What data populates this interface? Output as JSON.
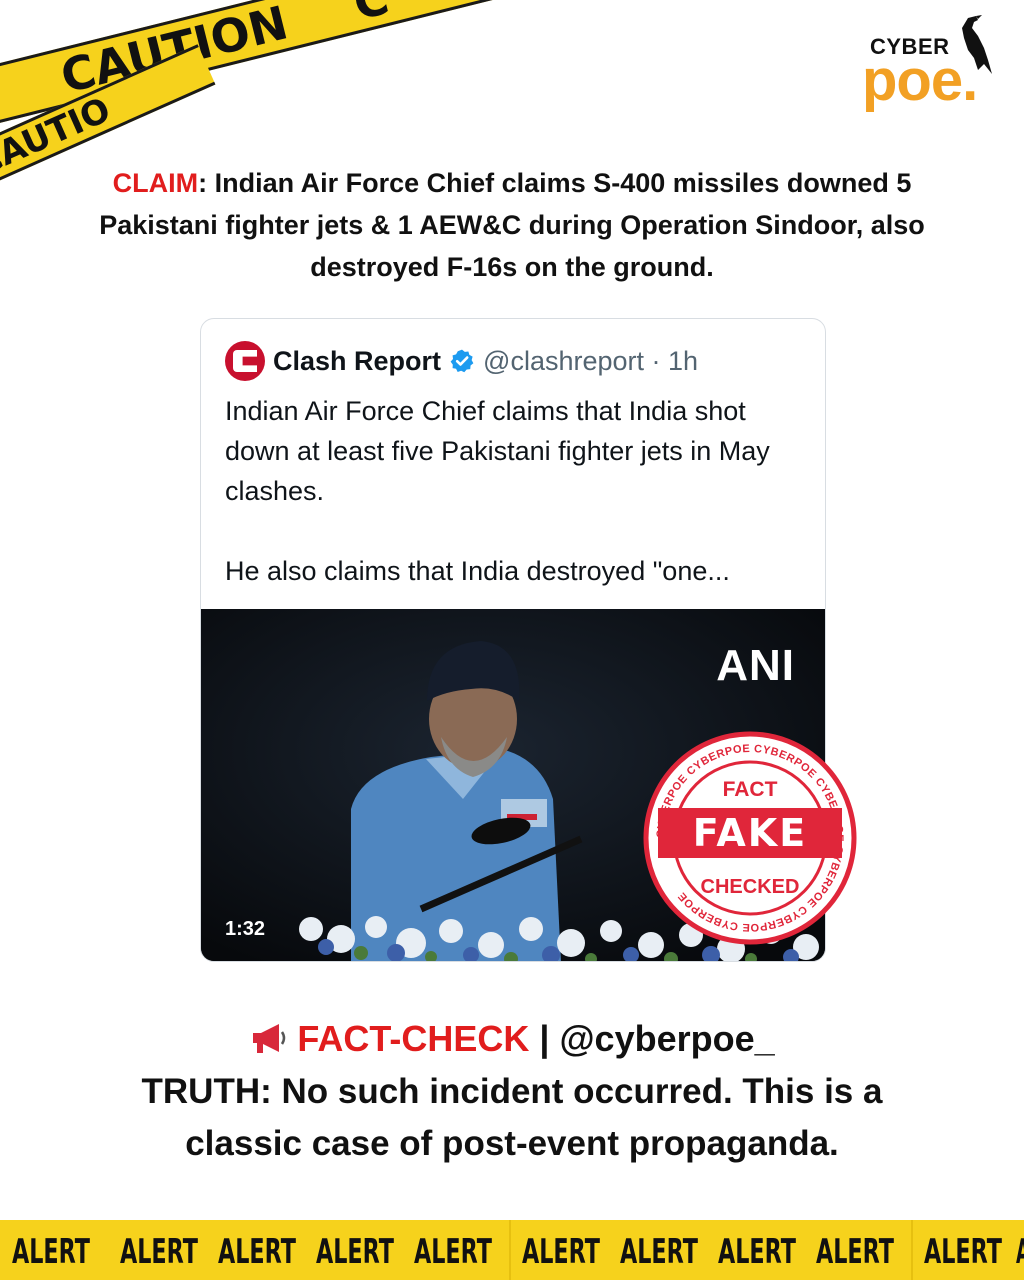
{
  "tape": {
    "top_labels": [
      "N",
      "CAUTION",
      "C"
    ],
    "bottom_label": "CAUTIO"
  },
  "logo": {
    "top": "CYBER",
    "bottom": "poe."
  },
  "claim": {
    "label": "CLAIM",
    "text": ": Indian Air Force Chief claims S-400 missiles downed 5 Pakistani fighter jets & 1 AEW&C during Operation Sindoor, also destroyed F-16s on the ground."
  },
  "tweet": {
    "author": "Clash Report",
    "handle": "@clashreport · 1h",
    "paragraph1": "Indian Air Force Chief claims that India shot down at least five Pakistani fighter jets in May clashes.",
    "paragraph2": "He also claims that India destroyed \"one...",
    "media_watermark": "ANI",
    "duration": "1:32"
  },
  "stamp": {
    "top": "FACT",
    "middle": "FAKE",
    "bottom": "CHECKED",
    "ring_text": "CYBERPOE CYBERPOE CYBERPOE CYBERPOE CYBERPOE CYBERPOE CYBERPOE"
  },
  "factcheck": {
    "label": "FACT-CHECK",
    "separator": " | ",
    "handle": "@cyberpoe_",
    "truth": "TRUTH: No such incident occurred. This is a classic case of post-event propaganda."
  },
  "alerts": [
    "ALERT",
    "ALERT",
    "ALERT",
    "ALERT",
    "ALERT",
    "ALERT",
    "ALERT",
    "ALERT",
    "ALERT",
    "ALERT",
    "A"
  ],
  "colors": {
    "accent_red": "#e11d1d",
    "tape_yellow": "#f6d21c",
    "logo_orange": "#f2a024",
    "verified_blue": "#1d9bf0"
  }
}
